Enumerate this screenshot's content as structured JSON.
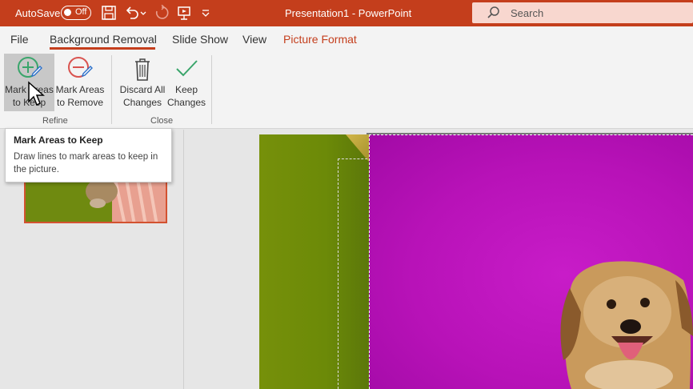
{
  "titlebar": {
    "autosave_label": "AutoSave",
    "autosave_state": "Off",
    "document_title": "Presentation1 - PowerPoint",
    "search_placeholder": "Search",
    "accent_color": "#c43e1c"
  },
  "tabs": [
    {
      "label": "File"
    },
    {
      "label": "Background Removal"
    },
    {
      "label": "Slide Show"
    },
    {
      "label": "View"
    },
    {
      "label": "Picture Format"
    }
  ],
  "ribbon": {
    "refine": {
      "label": "Refine",
      "mark_keep": {
        "line1": "Mark Areas",
        "line2": "to Keep",
        "icon": "plus-pencil-icon"
      },
      "mark_remove": {
        "line1": "Mark Areas",
        "line2": "to Remove",
        "icon": "minus-pencil-icon"
      }
    },
    "close": {
      "label": "Close",
      "discard": {
        "line1": "Discard All",
        "line2": "Changes",
        "icon": "trash-icon"
      },
      "keep": {
        "line1": "Keep",
        "line2": "Changes",
        "icon": "checkmark-icon"
      }
    }
  },
  "tooltip": {
    "title": "Mark Areas to Keep",
    "description": "Draw lines to mark areas to keep in the picture."
  }
}
